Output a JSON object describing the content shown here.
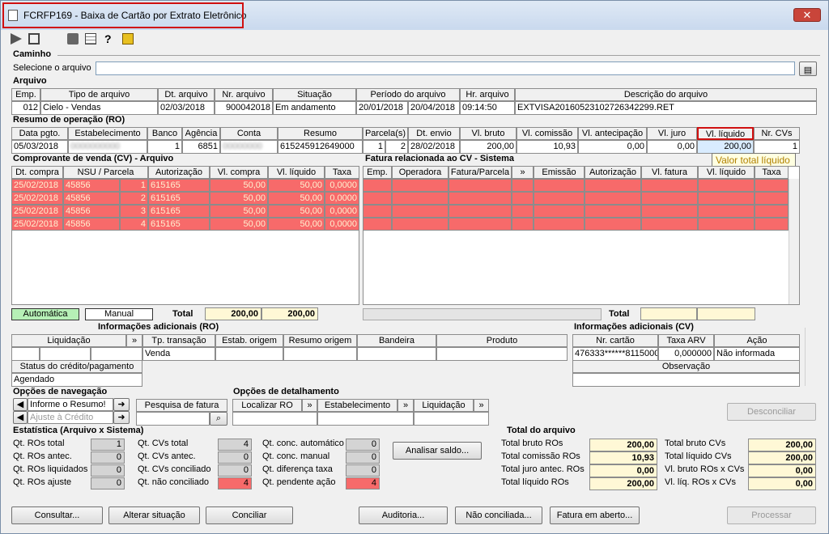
{
  "window": {
    "title": "FCRFP169 - Baixa de Cartão por Extrato Eletrônico",
    "close": "✕"
  },
  "caminho": {
    "section": "Caminho",
    "label": "Selecione o arquivo",
    "value": ""
  },
  "arquivo": {
    "section": "Arquivo",
    "headers": [
      "Emp.",
      "Tipo de arquivo",
      "Dt. arquivo",
      "Nr. arquivo",
      "Situação",
      "Período do arquivo",
      "Hr. arquivo",
      "Descrição do arquivo"
    ],
    "row": [
      "012",
      "Cielo - Vendas",
      "02/03/2018",
      "900042018",
      "Em andamento",
      "20/01/2018",
      "20/04/2018",
      "09:14:50",
      "EXTVISA20160523102726342299.RET"
    ]
  },
  "ro": {
    "section": "Resumo de operação (RO)",
    "headers": [
      "Data pgto.",
      "Estabelecimento",
      "Banco",
      "Agência",
      "Conta",
      "Resumo",
      "Parcela(s)",
      "Dt. envio",
      "Vl. bruto",
      "Vl. comissão",
      "Vl. antecipação",
      "Vl. juro",
      "Vl. líquido",
      "Nr. CVs"
    ],
    "row": [
      "05/03/2018",
      "0000000000",
      "1",
      "6851",
      "00000000",
      "615245912649000",
      "1",
      "2",
      "28/02/2018",
      "200,00",
      "10,93",
      "0,00",
      "0,00",
      "200,00",
      "1"
    ],
    "tooltip": "Valor total líquido"
  },
  "cv": {
    "section": "Comprovante de venda (CV) - Arquivo",
    "headers": [
      "Dt. compra",
      "NSU / Parcela",
      "Autorização",
      "Vl. compra",
      "Vl. líquido",
      "Taxa"
    ],
    "rows": [
      [
        "25/02/2018",
        "45856",
        "1",
        "615165",
        "50,00",
        "50,00",
        "0,0000"
      ],
      [
        "25/02/2018",
        "45856",
        "2",
        "615165",
        "50,00",
        "50,00",
        "0,0000"
      ],
      [
        "25/02/2018",
        "45856",
        "3",
        "615165",
        "50,00",
        "50,00",
        "0,0000"
      ],
      [
        "25/02/2018",
        "45856",
        "4",
        "615165",
        "50,00",
        "50,00",
        "0,0000"
      ]
    ],
    "auto": "Automática",
    "manual": "Manual",
    "total_label": "Total",
    "total_compra": "200,00",
    "total_liquido": "200,00"
  },
  "fatura": {
    "section": "Fatura relacionada ao CV - Sistema",
    "headers": [
      "Emp.",
      "Operadora",
      "Fatura/Parcela",
      "»",
      "Emissão",
      "Autorização",
      "Vl. fatura",
      "Vl. líquido",
      "Taxa"
    ],
    "total_label": "Total"
  },
  "info_ro": {
    "section": "Informações adicionais (RO)",
    "headers": [
      "Liquidação",
      "»",
      "Tp. transação",
      "Estab. origem",
      "Resumo origem",
      "Bandeira",
      "Produto"
    ],
    "tp": "Venda",
    "status_label": "Status do crédito/pagamento",
    "status": "Agendado"
  },
  "info_cv": {
    "section": "Informações adicionais (CV)",
    "headers": [
      "Nr. cartão",
      "Taxa ARV",
      "Ação"
    ],
    "cartao": "476333******8115000",
    "taxa": "0,000000",
    "acao": "Não informada",
    "obs": "Observação"
  },
  "nav": {
    "section": "Opções de navegação",
    "item1": "Informe o Resumo!",
    "item2": "Ajuste à Crédito",
    "pesquisa": "Pesquisa de fatura"
  },
  "detalhe": {
    "section": "Opções de detalhamento",
    "cols": [
      "Localizar RO",
      "»",
      "Estabelecimento",
      "»",
      "Liquidação",
      "»"
    ]
  },
  "desconciliar": "Desconciliar",
  "estat": {
    "section": "Estatística (Arquivo x Sistema)",
    "c1": [
      [
        "Qt. ROs total",
        "1"
      ],
      [
        "Qt. ROs antec.",
        "0"
      ],
      [
        "Qt. ROs liquidados",
        "0"
      ],
      [
        "Qt. ROs ajuste",
        "0"
      ]
    ],
    "c2": [
      [
        "Qt. CVs total",
        "4"
      ],
      [
        "Qt. CVs antec.",
        "0"
      ],
      [
        "Qt. CVs conciliado",
        "0"
      ],
      [
        "Qt. não conciliado",
        "4"
      ]
    ],
    "c3": [
      [
        "Qt. conc. automático",
        "0"
      ],
      [
        "Qt. conc. manual",
        "0"
      ],
      [
        "Qt. diferença taxa",
        "0"
      ],
      [
        "Qt. pendente ação",
        "4"
      ]
    ],
    "analisar": "Analisar saldo..."
  },
  "totarq": {
    "section": "Total do arquivo",
    "c1": [
      [
        "Total bruto ROs",
        "200,00"
      ],
      [
        "Total comissão ROs",
        "10,93"
      ],
      [
        "Total juro antec. ROs",
        "0,00"
      ],
      [
        "Total líquido ROs",
        "200,00"
      ]
    ],
    "c2": [
      [
        "Total bruto CVs",
        "200,00"
      ],
      [
        "Total líquido CVs",
        "200,00"
      ],
      [
        "Vl. bruto ROs x CVs",
        "0,00"
      ],
      [
        "Vl. líq. ROs x CVs",
        "0,00"
      ]
    ]
  },
  "buttons": [
    "Consultar...",
    "Alterar situação",
    "Conciliar",
    "Auditoria...",
    "Não conciliada...",
    "Fatura em aberto...",
    "Processar"
  ]
}
